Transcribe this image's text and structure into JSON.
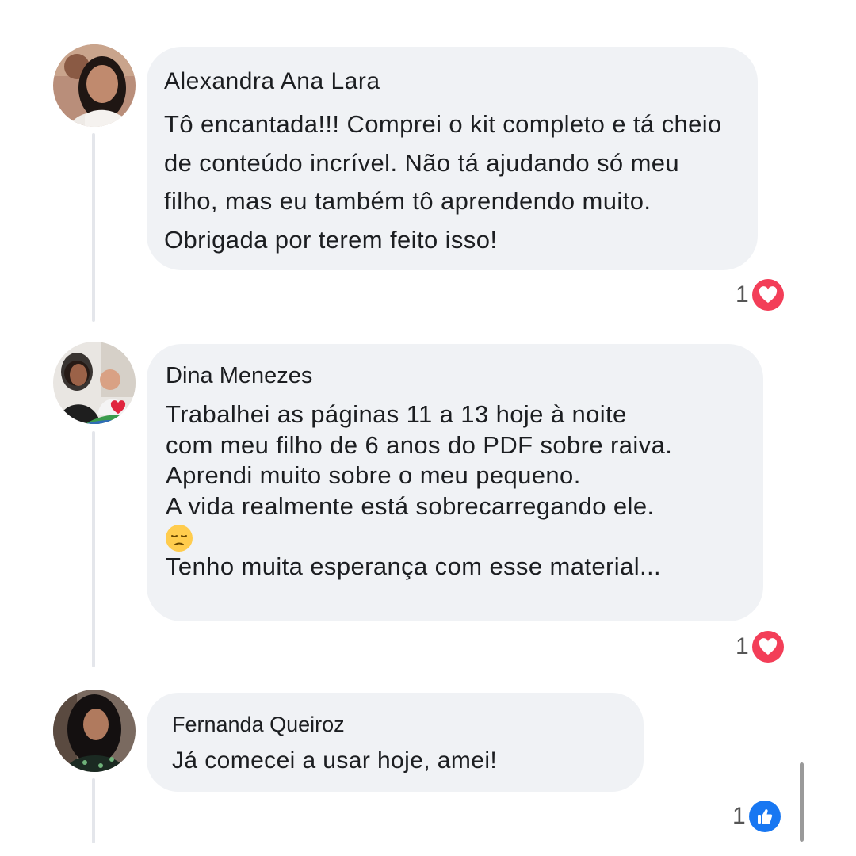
{
  "comments": [
    {
      "author": "Alexandra Ana Lara",
      "text": "Tô encantada!!! Comprei o kit completo e tá cheio de conteúdo incrível. Não tá ajudando só meu filho, mas eu também tô aprendendo muito. Obrigada por terem feito isso!",
      "reaction": {
        "count": "1",
        "icon": "heart-icon"
      }
    },
    {
      "author": "Dina Menezes",
      "text_lines": [
        "Trabalhei as páginas 11 a 13 hoje à noite",
        "com meu filho de 6 anos do PDF sobre raiva.",
        "Aprendi muito sobre o meu pequeno.",
        "A vida realmente está sobrecarregando ele."
      ],
      "emoji": "pensive-face-emoji",
      "text_after": "Tenho muita esperança com esse material...",
      "reaction": {
        "count": "1",
        "icon": "heart-icon"
      }
    },
    {
      "author": "Fernanda Queiroz",
      "text": "Já comecei a usar hoje, amei!",
      "reaction": {
        "count": "1",
        "icon": "like-icon"
      }
    }
  ],
  "colors": {
    "bubble": "#f0f2f5",
    "heart": "#f33e58",
    "like": "#1877f2",
    "thread_line": "#e4e6eb"
  }
}
